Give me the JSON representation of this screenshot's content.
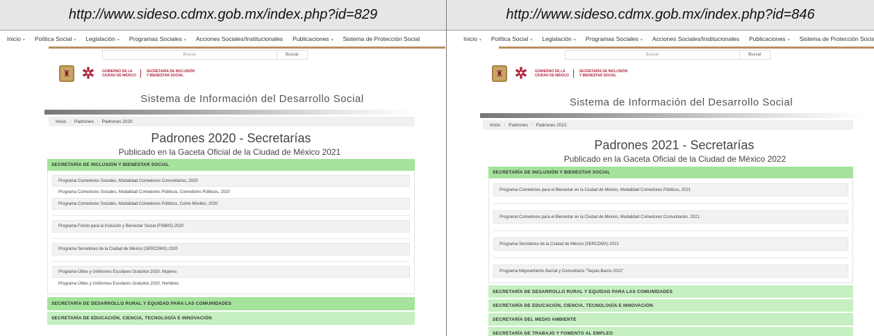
{
  "captions": {
    "left": "http://www.sideso.cdmx.gob.mx/index.php?id=829",
    "right": "http://www.sideso.cdmx.gob.mx/index.php?id=846"
  },
  "nav": {
    "items": [
      "Inicio",
      "Política Social",
      "Legislación",
      "Programas Sociales",
      "Acciones Sociales/Institucionales",
      "Publicaciones",
      "Sistema de Protección Social"
    ],
    "caret": "▾"
  },
  "search": {
    "placeholder": "Buscar",
    "button": "Buscar"
  },
  "logo": {
    "gov_line1": "GOBIERNO DE LA",
    "gov_line2": "CIUDAD DE MÉXICO",
    "secr_line1": "SECRETARÍA DE INCLUSIÓN",
    "secr_line2": "Y BIENESTAR SOCIAL",
    "brand_color": "#b0273e"
  },
  "system_title": "Sistema de Información del Desarrollo Social",
  "left": {
    "breadcrumb": [
      "Inicio",
      "Padrones",
      "Padrones 2020"
    ],
    "title": "Padrones 2020 - Secretarías",
    "subtitle": "Publicado en la Gaceta Oficial de la Ciudad de México 2021",
    "section1": "SECRETARÍA DE INCLUSIÓN Y BIENESTAR SOCIAL",
    "programs": [
      "Programa Comedores Sociales, Modalidad Comedores Comunitarios, 2020",
      "Programa Comedores Sociales, Modalidad Comedores Públicos, Comedores Públicos, 2020",
      "Programa Comedores Sociales, Modalidad Comedores Públicos, Come Móviles, 2020",
      "Programa Fondo para la Inclusión y Bienestar Social (FINBIS) 2020",
      "Programa Servidores de la Ciudad de México (SERCDMX) 2020",
      "Programa Útiles y Uniformes Escolares Gratuitos 2020, Mujeres",
      "Programa Útiles y Uniformes Escolares Gratuitos 2020, Hombres"
    ],
    "section2": "SECRETARÍA DE DESARROLLO RURAL Y EQUIDAD PARA LAS COMUNIDADES",
    "section3": "SECRETARÍA DE EDUCACIÓN, CIENCIA, TECNOLOGÍA E INNOVACIÓN"
  },
  "right": {
    "breadcrumb": [
      "Inicio",
      "Padrones",
      "Padrones 2021"
    ],
    "title": "Padrones 2021 - Secretarías",
    "subtitle": "Publicado en la Gaceta Oficial de la Ciudad de México 2022",
    "section1": "SECRETARÍA DE INCLUSIÓN Y BIENESTAR SOCIAL",
    "programs": [
      "Programa Comedores para el Bienestar en la Ciudad de México, Modalidad Comedores Públicos, 2021",
      "Programa Comedores para el Bienestar en la Ciudad de México, Modalidad Comedores Comunitarios, 2021",
      "Programa Servidores de la Ciudad de México (SERCDMX) 2021",
      "Programa Mejoramiento Barrial y Comunitario \"Tequio-Barrio 2021\""
    ],
    "section2": "SECRETARÍA DE DESARROLLO RURAL Y EQUIDAD PARA LAS COMUNIDADES",
    "section3": "SECRETARÍA DE EDUCACIÓN, CIENCIA, TECNOLOGÍA E INNOVACIÓN",
    "section4": "SECRETARÍA DEL MEDIO AMBIENTE",
    "section5": "SECRETARÍA DE TRABAJO Y FOMENTO AL EMPLEO"
  }
}
